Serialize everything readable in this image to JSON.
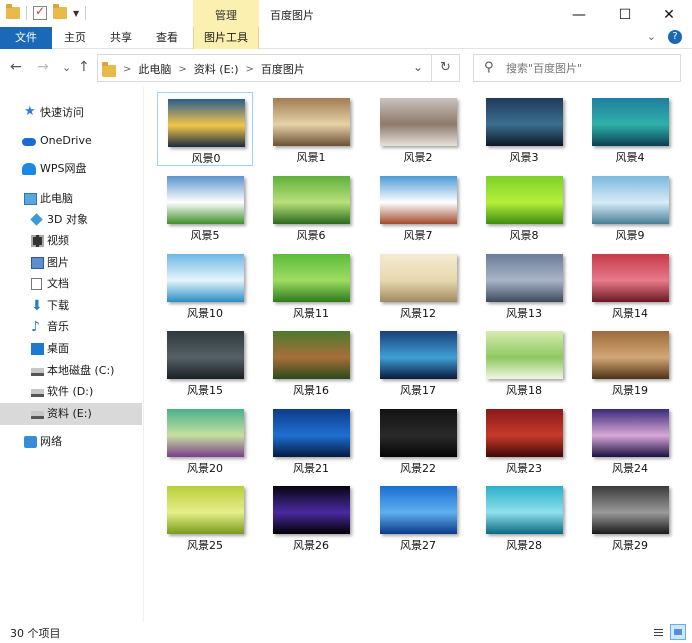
{
  "titlebar": {
    "context_tab": "管理",
    "window_title": "百度图片",
    "min_glyph": "—",
    "max_glyph": "☐",
    "close_glyph": "✕"
  },
  "ribbon": {
    "file": "文件",
    "home": "主页",
    "share": "共享",
    "view": "查看",
    "picture_tools": "图片工具",
    "expand_glyph": "⌄",
    "help_glyph": "?"
  },
  "nav": {
    "back": "←",
    "forward": "→",
    "recent": "⌄",
    "up": "↑"
  },
  "address": {
    "crumbs": [
      "此电脑",
      "资料 (E:)",
      "百度图片"
    ],
    "sep": ">",
    "drop": "⌄",
    "refresh": "↻"
  },
  "search": {
    "icon": "⚲",
    "placeholder": "搜索\"百度图片\""
  },
  "sidebar": {
    "items": [
      {
        "label": "快速访问",
        "icon": "star-icon"
      },
      {
        "label": "OneDrive",
        "icon": "cloud-icon"
      },
      {
        "label": "WPS网盘",
        "icon": "wps-cloud-icon"
      },
      {
        "label": "此电脑",
        "icon": "computer-icon"
      },
      {
        "label": "3D 对象",
        "icon": "3d-objects-icon"
      },
      {
        "label": "视频",
        "icon": "video-icon"
      },
      {
        "label": "图片",
        "icon": "pictures-icon"
      },
      {
        "label": "文档",
        "icon": "documents-icon"
      },
      {
        "label": "下载",
        "icon": "download-icon"
      },
      {
        "label": "音乐",
        "icon": "music-icon"
      },
      {
        "label": "桌面",
        "icon": "desktop-icon"
      },
      {
        "label": "本地磁盘 (C:)",
        "icon": "drive-icon"
      },
      {
        "label": "软件 (D:)",
        "icon": "drive-icon"
      },
      {
        "label": "资料 (E:)",
        "icon": "drive-icon"
      },
      {
        "label": "网络",
        "icon": "network-icon"
      }
    ],
    "glyphs": {
      "star": "★",
      "down": "⬇",
      "music": "♪"
    }
  },
  "files": [
    {
      "name": "风景0",
      "colors": [
        "#2a5c8f",
        "#f3c64a",
        "#1a2c40"
      ]
    },
    {
      "name": "风景1",
      "colors": [
        "#a17d52",
        "#e6d1a8",
        "#6b5034"
      ]
    },
    {
      "name": "风景2",
      "colors": [
        "#c9c2bd",
        "#8f7a6a",
        "#e8e2dc"
      ]
    },
    {
      "name": "风景3",
      "colors": [
        "#203a5a",
        "#3c6f8f",
        "#0c1826"
      ]
    },
    {
      "name": "风景4",
      "colors": [
        "#1f7fa0",
        "#2fb0a8",
        "#0a3f55"
      ]
    },
    {
      "name": "风景5",
      "colors": [
        "#5b94cf",
        "#ffffff",
        "#3f8f2a"
      ]
    },
    {
      "name": "风景6",
      "colors": [
        "#5fb03c",
        "#b8e07a",
        "#2b6a1e"
      ]
    },
    {
      "name": "风景7",
      "colors": [
        "#4d9bd6",
        "#ffffff",
        "#a04a2e"
      ]
    },
    {
      "name": "风景8",
      "colors": [
        "#7cd12a",
        "#b6ef3a",
        "#3f8d12"
      ]
    },
    {
      "name": "风景9",
      "colors": [
        "#7bb8de",
        "#d6ecf8",
        "#4a7e96"
      ]
    },
    {
      "name": "风景10",
      "colors": [
        "#6fb7e5",
        "#e6f4fb",
        "#2a8fc4"
      ]
    },
    {
      "name": "风景11",
      "colors": [
        "#5dbb3c",
        "#9fdc62",
        "#2e7a1d"
      ]
    },
    {
      "name": "风景12",
      "colors": [
        "#f5ead0",
        "#e8d8b0",
        "#a08a60"
      ]
    },
    {
      "name": "风景13",
      "colors": [
        "#6b7d9a",
        "#a9b4c6",
        "#3d4a5e"
      ]
    },
    {
      "name": "风景14",
      "colors": [
        "#c73a4a",
        "#e87a8a",
        "#6a1a22"
      ]
    },
    {
      "name": "风景15",
      "colors": [
        "#2f3a3f",
        "#556066",
        "#1a2024"
      ]
    },
    {
      "name": "风景16",
      "colors": [
        "#4d7a2e",
        "#a86e3a",
        "#2a4a1a"
      ]
    },
    {
      "name": "风景17",
      "colors": [
        "#1a3f7a",
        "#3fa0d6",
        "#0a1a3a"
      ]
    },
    {
      "name": "风景18",
      "colors": [
        "#d7ecb0",
        "#8fc860",
        "#f0f7e2"
      ]
    },
    {
      "name": "风景19",
      "colors": [
        "#9c6b3a",
        "#d2a775",
        "#4e3216"
      ]
    },
    {
      "name": "风景20",
      "colors": [
        "#4ab08a",
        "#c6e0a0",
        "#7a3f8a"
      ]
    },
    {
      "name": "风景21",
      "colors": [
        "#0d3c8a",
        "#1f6fd1",
        "#051a40"
      ]
    },
    {
      "name": "风景22",
      "colors": [
        "#121212",
        "#2a2a2a",
        "#050505"
      ]
    },
    {
      "name": "风景23",
      "colors": [
        "#8a1a1a",
        "#c83a2a",
        "#3f0808"
      ]
    },
    {
      "name": "风景24",
      "colors": [
        "#3a2a7a",
        "#d8a8d8",
        "#1a1040"
      ]
    },
    {
      "name": "风景25",
      "colors": [
        "#b9cf3a",
        "#e6ee8a",
        "#7a9a1a"
      ]
    },
    {
      "name": "风景26",
      "colors": [
        "#050510",
        "#4a2aa0",
        "#000000"
      ]
    },
    {
      "name": "风景27",
      "colors": [
        "#1a6fd1",
        "#5fb0f0",
        "#0a3a8a"
      ]
    },
    {
      "name": "风景28",
      "colors": [
        "#2ab0c8",
        "#8fe0ee",
        "#0a6a80"
      ]
    },
    {
      "name": "风景29",
      "colors": [
        "#3a3a3a",
        "#9a9a9a",
        "#1a1a1a"
      ]
    }
  ],
  "status": {
    "count": "30 个项目"
  }
}
